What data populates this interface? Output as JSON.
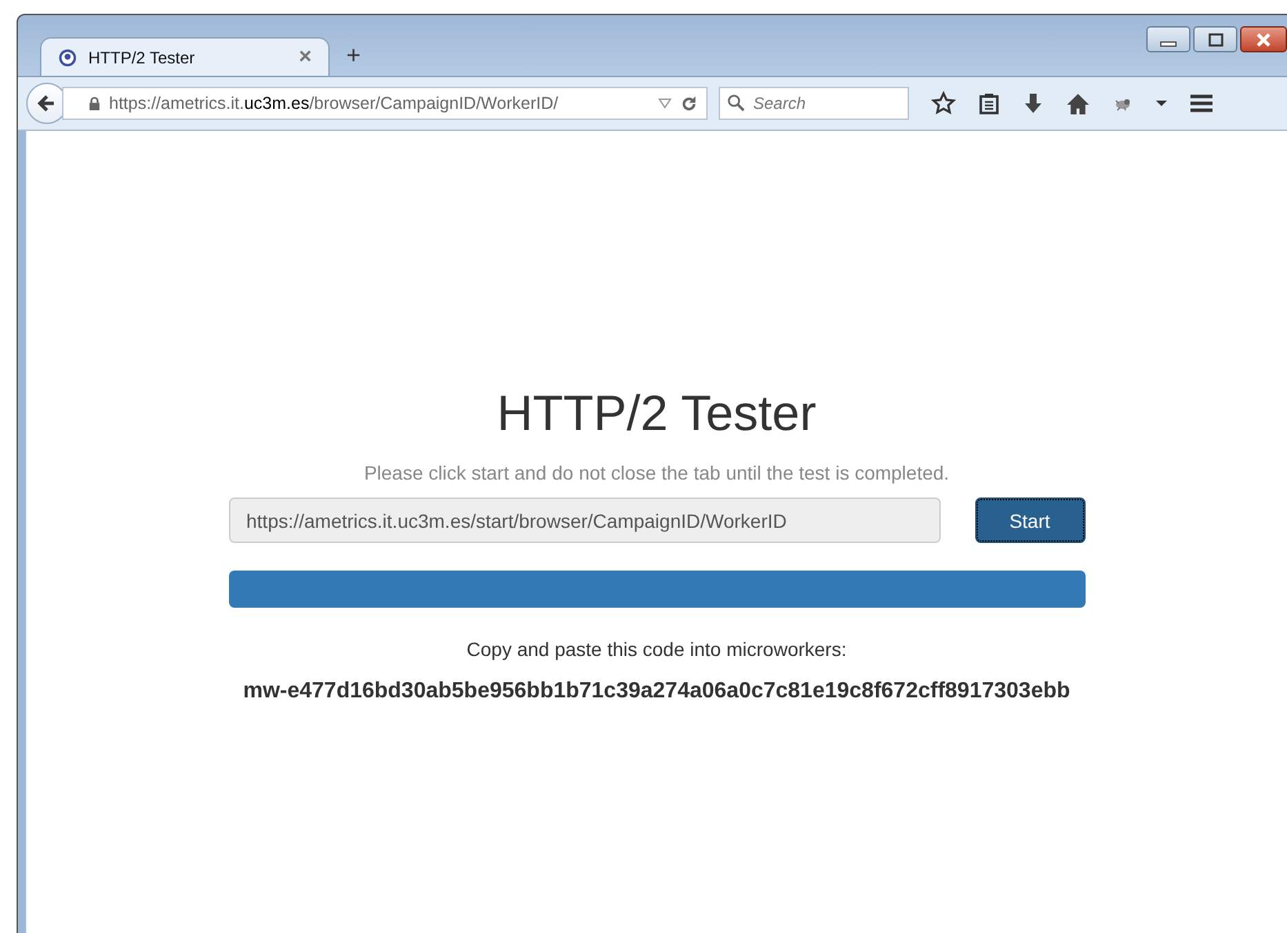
{
  "tab": {
    "title": "HTTP/2 Tester",
    "selected": true,
    "close": "×"
  },
  "new_tab": "+",
  "address_bar": {
    "url": "https://ametrics.it.**uc3m.es**/browser/CampaignID/WorkerID/"
  },
  "search": {
    "placeholder": "Search"
  },
  "page": {
    "title": "HTTP/2 Tester",
    "instructions": "Please click start and do not close the tab until the test is completed.",
    "url_field": {
      "value": "https://ametrics.it.uc3m.es/start/browser/CampaignID/WorkerID"
    },
    "start_button": "Start",
    "code_label": "Copy and paste this code into microworkers:",
    "code": "mw-e477d16bd30ab5be956bb1b71c39a274a06a0c7c81e19c8f672cff8917303ebb"
  }
}
